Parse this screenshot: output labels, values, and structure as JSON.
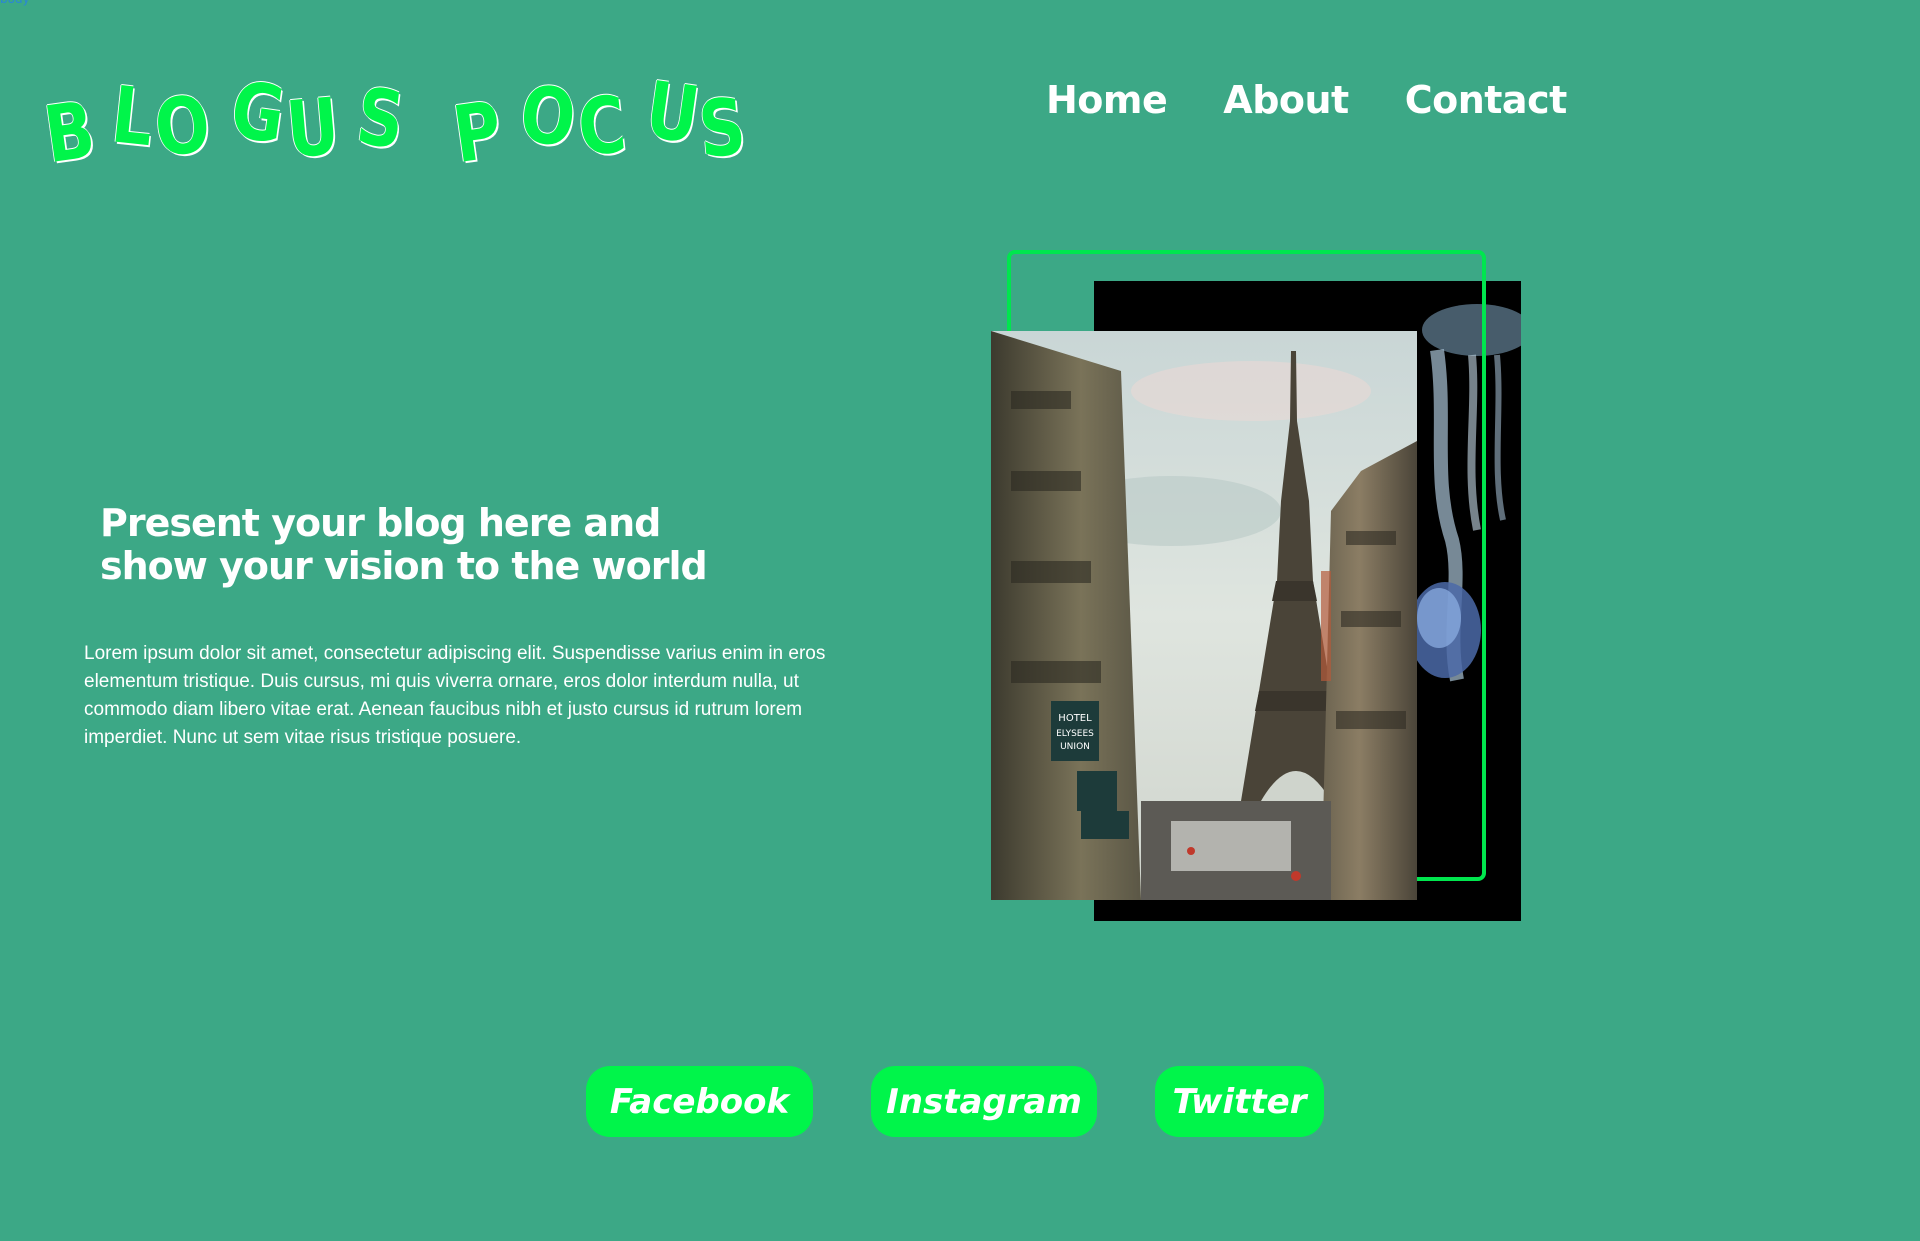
{
  "page": {
    "corner_label": "body",
    "brand_color": "#00f54a",
    "background_color": "#3ca886"
  },
  "logo": {
    "word1": "BLOGUS",
    "word2": "POCUS"
  },
  "nav": {
    "items": [
      "Home",
      "About",
      "Contact"
    ]
  },
  "hero": {
    "headline": "Present your blog here and show your vision to the world",
    "body": "Lorem ipsum dolor sit amet, consectetur adipiscing elit. Suspendisse varius enim in eros elementum tristique. Duis cursus, mi quis viverra ornare, eros dolor interdum nulla, ut commodo diam libero vitae erat. Aenean faucibus nibh et justo cursus id rutrum lorem imperdiet. Nunc ut sem vitae risus tristique posuere."
  },
  "images": {
    "main_photo_signs": [
      "HOTEL",
      "ELYSEES",
      "UNION"
    ],
    "accent_frame_color": "#00e64e"
  },
  "social": {
    "buttons": [
      "Facebook",
      "Instagram",
      "Twitter"
    ]
  }
}
